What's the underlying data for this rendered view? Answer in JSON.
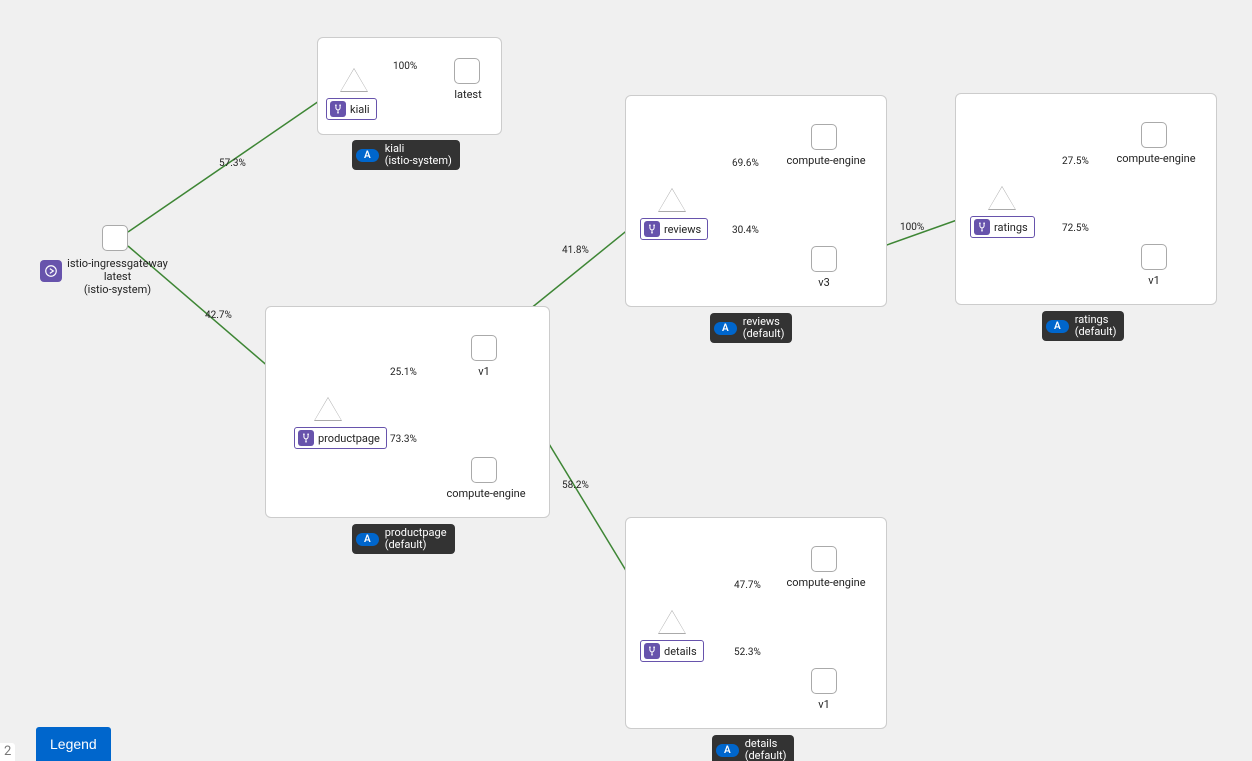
{
  "root_node": {
    "line1": "istio-ingressgateway",
    "line2": "latest",
    "line3": "(istio-system)"
  },
  "groups": {
    "kiali": {
      "label_line1": "kiali",
      "label_line2": "(istio-system)",
      "service_name": "kiali",
      "workloads": [
        "latest"
      ]
    },
    "productpage": {
      "label_line1": "productpage",
      "label_line2": "(default)",
      "service_name": "productpage",
      "workloads": [
        "v1",
        "compute-engine"
      ]
    },
    "reviews": {
      "label_line1": "reviews",
      "label_line2": "(default)",
      "service_name": "reviews",
      "workloads": [
        "compute-engine",
        "v3"
      ]
    },
    "details": {
      "label_line1": "details",
      "label_line2": "(default)",
      "service_name": "details",
      "workloads": [
        "compute-engine",
        "v1"
      ]
    },
    "ratings": {
      "label_line1": "ratings",
      "label_line2": "(default)",
      "service_name": "ratings",
      "workloads": [
        "compute-engine",
        "v1"
      ]
    }
  },
  "edges": {
    "root_to_kiali": "57.3%",
    "root_to_productpage": "42.7%",
    "kiali_to_latest": "100%",
    "productpage_to_v1": "25.1%",
    "productpage_to_ce": "73.3%",
    "v1_to_reviews": "41.8%",
    "v1_to_details": "58.2%",
    "reviews_to_ce": "69.6%",
    "reviews_to_v3": "30.4%",
    "v3_to_ratings": "100%",
    "ratings_to_ce": "27.5%",
    "ratings_to_v1": "72.5%",
    "details_to_ce": "47.7%",
    "details_to_v1": "52.3%"
  },
  "badges": {
    "app": "A"
  },
  "legend_button": "Legend",
  "corner_mark": "2"
}
